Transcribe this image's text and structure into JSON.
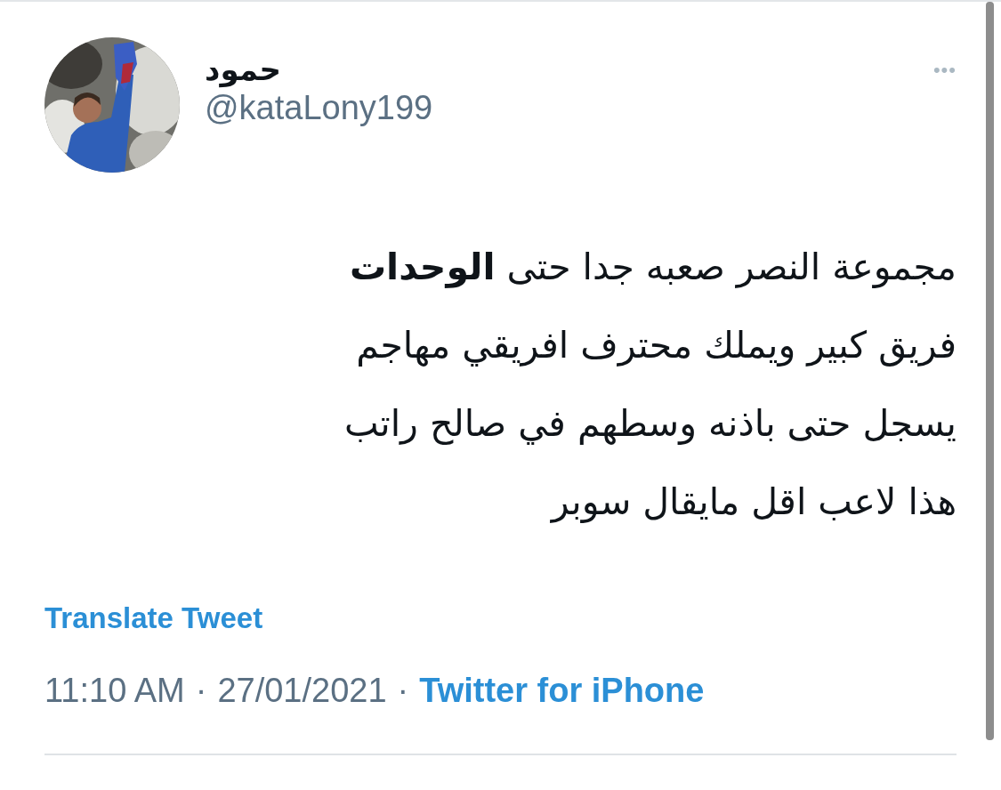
{
  "author": {
    "name": "حمود",
    "handle": "@kataLony199"
  },
  "more_menu": {
    "label": "•••"
  },
  "tweet": {
    "lines": [
      "مجموعة النصر  صعبه جدا حتى **الوحدات**",
      "فريق كبير ويملك محترف افريقي مهاجم",
      "يسجل حتى باذنه وسطهم في صالح راتب",
      "هذا لاعب اقل مايقال سوبر"
    ]
  },
  "translate_link": "Translate Tweet",
  "meta": {
    "time": "11:10 AM",
    "date": "27/01/2021",
    "separator": "·",
    "source": "Twitter for iPhone"
  }
}
